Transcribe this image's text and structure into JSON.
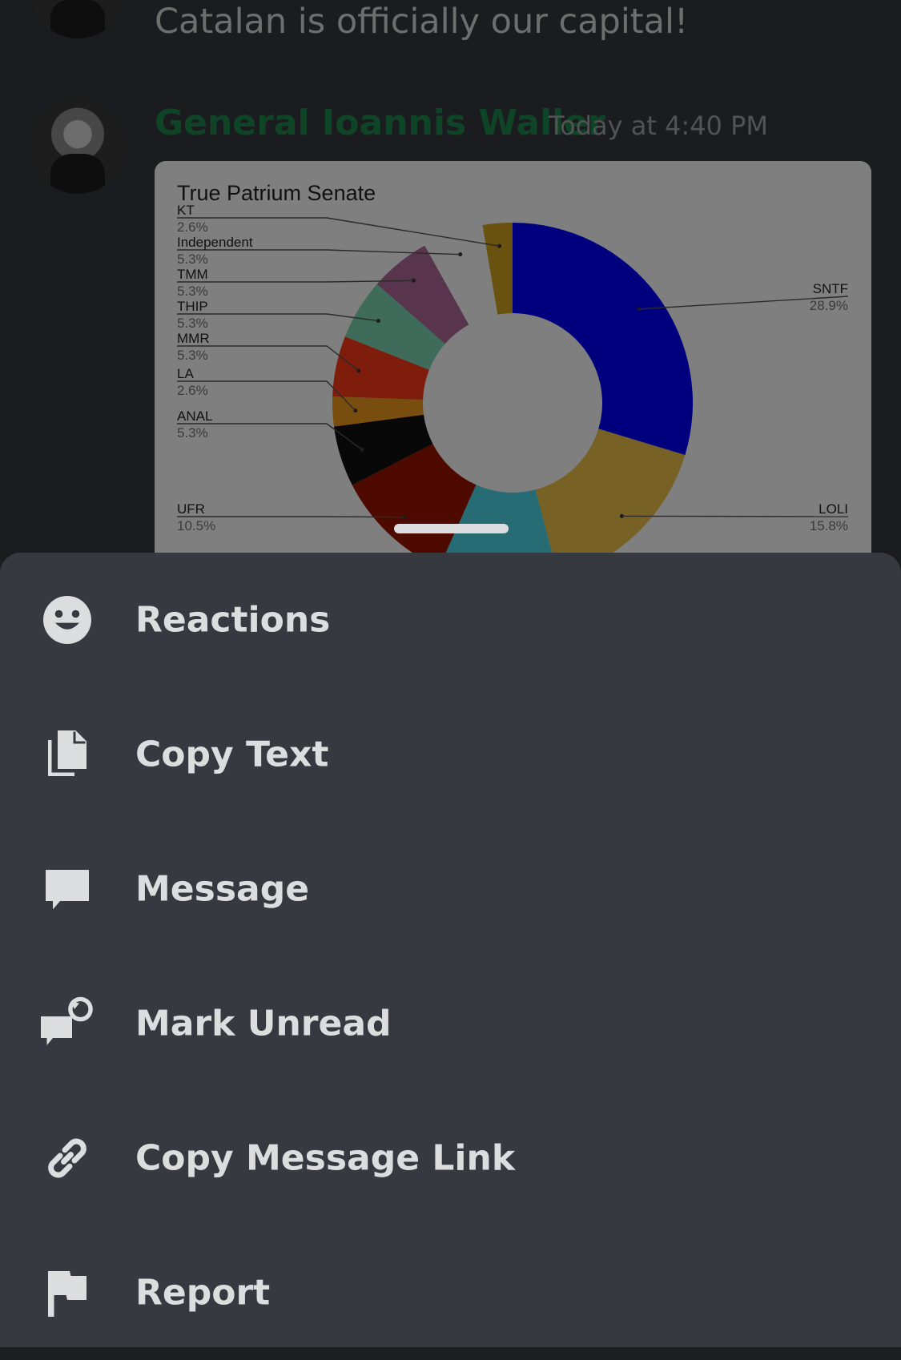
{
  "chat": {
    "previous_message": "Catalan is officially our capital!",
    "message": {
      "author": "General Ioannis Waller",
      "timestamp": "Today at 4:40 PM"
    }
  },
  "chart_data": {
    "type": "pie",
    "title": "True Patrium Senate",
    "donut": true,
    "slices": [
      {
        "label": "SNTF",
        "percent": "28.9%",
        "value": 28.9,
        "color": "#0000ff",
        "side": "right"
      },
      {
        "label": "LOLI",
        "percent": "15.8%",
        "value": 15.8,
        "color": "#f0c24a",
        "side": "right"
      },
      {
        "label": "",
        "percent": "",
        "value": 10.5,
        "color": "#4fd6e8",
        "side": "none"
      },
      {
        "label": "UFR",
        "percent": "10.5%",
        "value": 10.5,
        "color": "#9e1400",
        "side": "left"
      },
      {
        "label": "ANAL",
        "percent": "5.3%",
        "value": 5.3,
        "color": "#111111",
        "side": "left"
      },
      {
        "label": "LA",
        "percent": "2.6%",
        "value": 2.6,
        "color": "#f29a1c",
        "side": "left"
      },
      {
        "label": "MMR",
        "percent": "5.3%",
        "value": 5.3,
        "color": "#ff3a1a",
        "side": "left"
      },
      {
        "label": "THIP",
        "percent": "5.3%",
        "value": 5.3,
        "color": "#7ed8b4",
        "side": "left"
      },
      {
        "label": "TMM",
        "percent": "5.3%",
        "value": 5.3,
        "color": "#b06a9a",
        "side": "left"
      },
      {
        "label": "Independent",
        "percent": "5.3%",
        "value": 5.3,
        "color": "#ffffff",
        "side": "left"
      },
      {
        "label": "KT",
        "percent": "2.6%",
        "value": 2.6,
        "color": "#d2a21e",
        "side": "left"
      }
    ]
  },
  "sheet": {
    "items": [
      {
        "label": "Reactions",
        "icon": "smiley-icon"
      },
      {
        "label": "Copy Text",
        "icon": "copy-icon"
      },
      {
        "label": "Message",
        "icon": "chat-bubble-icon"
      },
      {
        "label": "Mark Unread",
        "icon": "mark-unread-icon"
      },
      {
        "label": "Copy Message Link",
        "icon": "link-icon"
      },
      {
        "label": "Report",
        "icon": "flag-icon"
      }
    ]
  }
}
